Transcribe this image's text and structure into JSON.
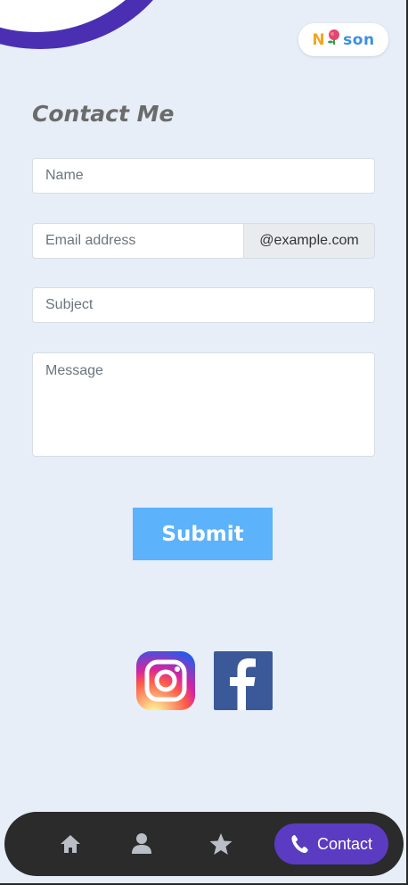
{
  "logo": {
    "part1": "N",
    "part2": "son"
  },
  "page": {
    "title": "Contact Me"
  },
  "form": {
    "name_placeholder": "Name",
    "email_placeholder": "Email address",
    "email_suffix": "@example.com",
    "subject_placeholder": "Subject",
    "message_placeholder": "Message",
    "submit_label": "Submit"
  },
  "social": [
    "instagram-icon",
    "facebook-icon"
  ],
  "nav": {
    "items": [
      "home-icon",
      "user-icon",
      "star-icon"
    ],
    "active_label": "Contact"
  },
  "colors": {
    "background": "#e7eef8",
    "accent": "#5b3bc1",
    "submit": "#5cb2fb",
    "navbar": "#2b2b2b"
  }
}
